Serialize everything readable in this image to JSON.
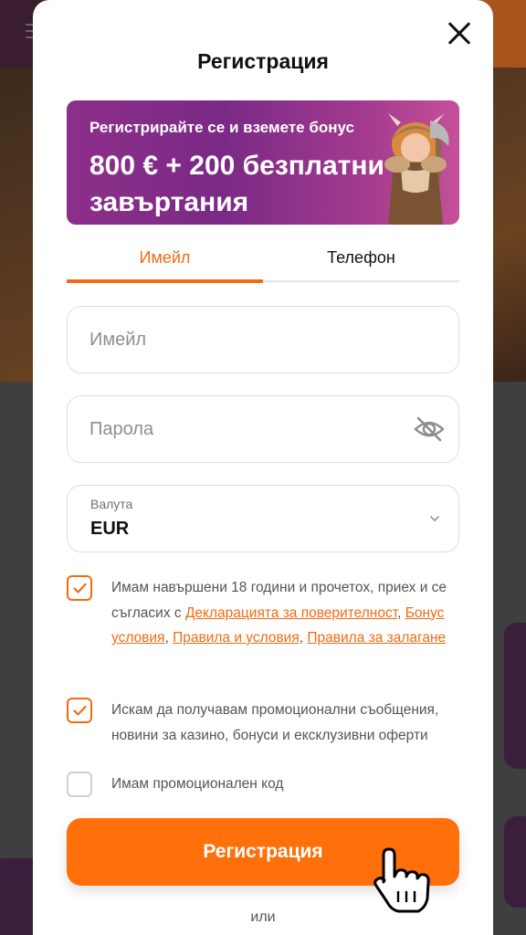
{
  "modal": {
    "title": "Регистрация"
  },
  "banner": {
    "subtitle": "Регистрирайте се и вземете бонус",
    "headline": "800 € + 200 безплатни завъртания"
  },
  "tabs": [
    {
      "label": "Имейл",
      "active": true
    },
    {
      "label": "Телефон",
      "active": false
    }
  ],
  "form": {
    "email_placeholder": "Имейл",
    "password_placeholder": "Парола",
    "currency_label": "Валута",
    "currency_value": "EUR"
  },
  "checkboxes": {
    "age": {
      "checked": true,
      "text_before": "Имам навършени 18 години и прочетох, приех и се съгласих с ",
      "link_privacy": "Декларацията за поверителност",
      "sep1": ", ",
      "link_bonus": "Бонус условия",
      "sep2": ", ",
      "link_terms": "Правила и условия",
      "sep3": ", ",
      "link_betting": "Правила за залагане"
    },
    "promo_messages": {
      "checked": true,
      "text": "Искам да получавам промоционални съобщения, новини за казино, бонуси и ексклузивни оферти"
    },
    "promo_code": {
      "checked": false,
      "text": "Имам промоционален код"
    }
  },
  "submit_label": "Регистрация",
  "or_label": "или",
  "colors": {
    "accent": "#ff6f0a",
    "banner": "#8d2f8a"
  },
  "icons": [
    "close-icon",
    "eye-off-icon",
    "chevron-down-icon",
    "checkmark-icon",
    "hand-pointer-icon"
  ]
}
